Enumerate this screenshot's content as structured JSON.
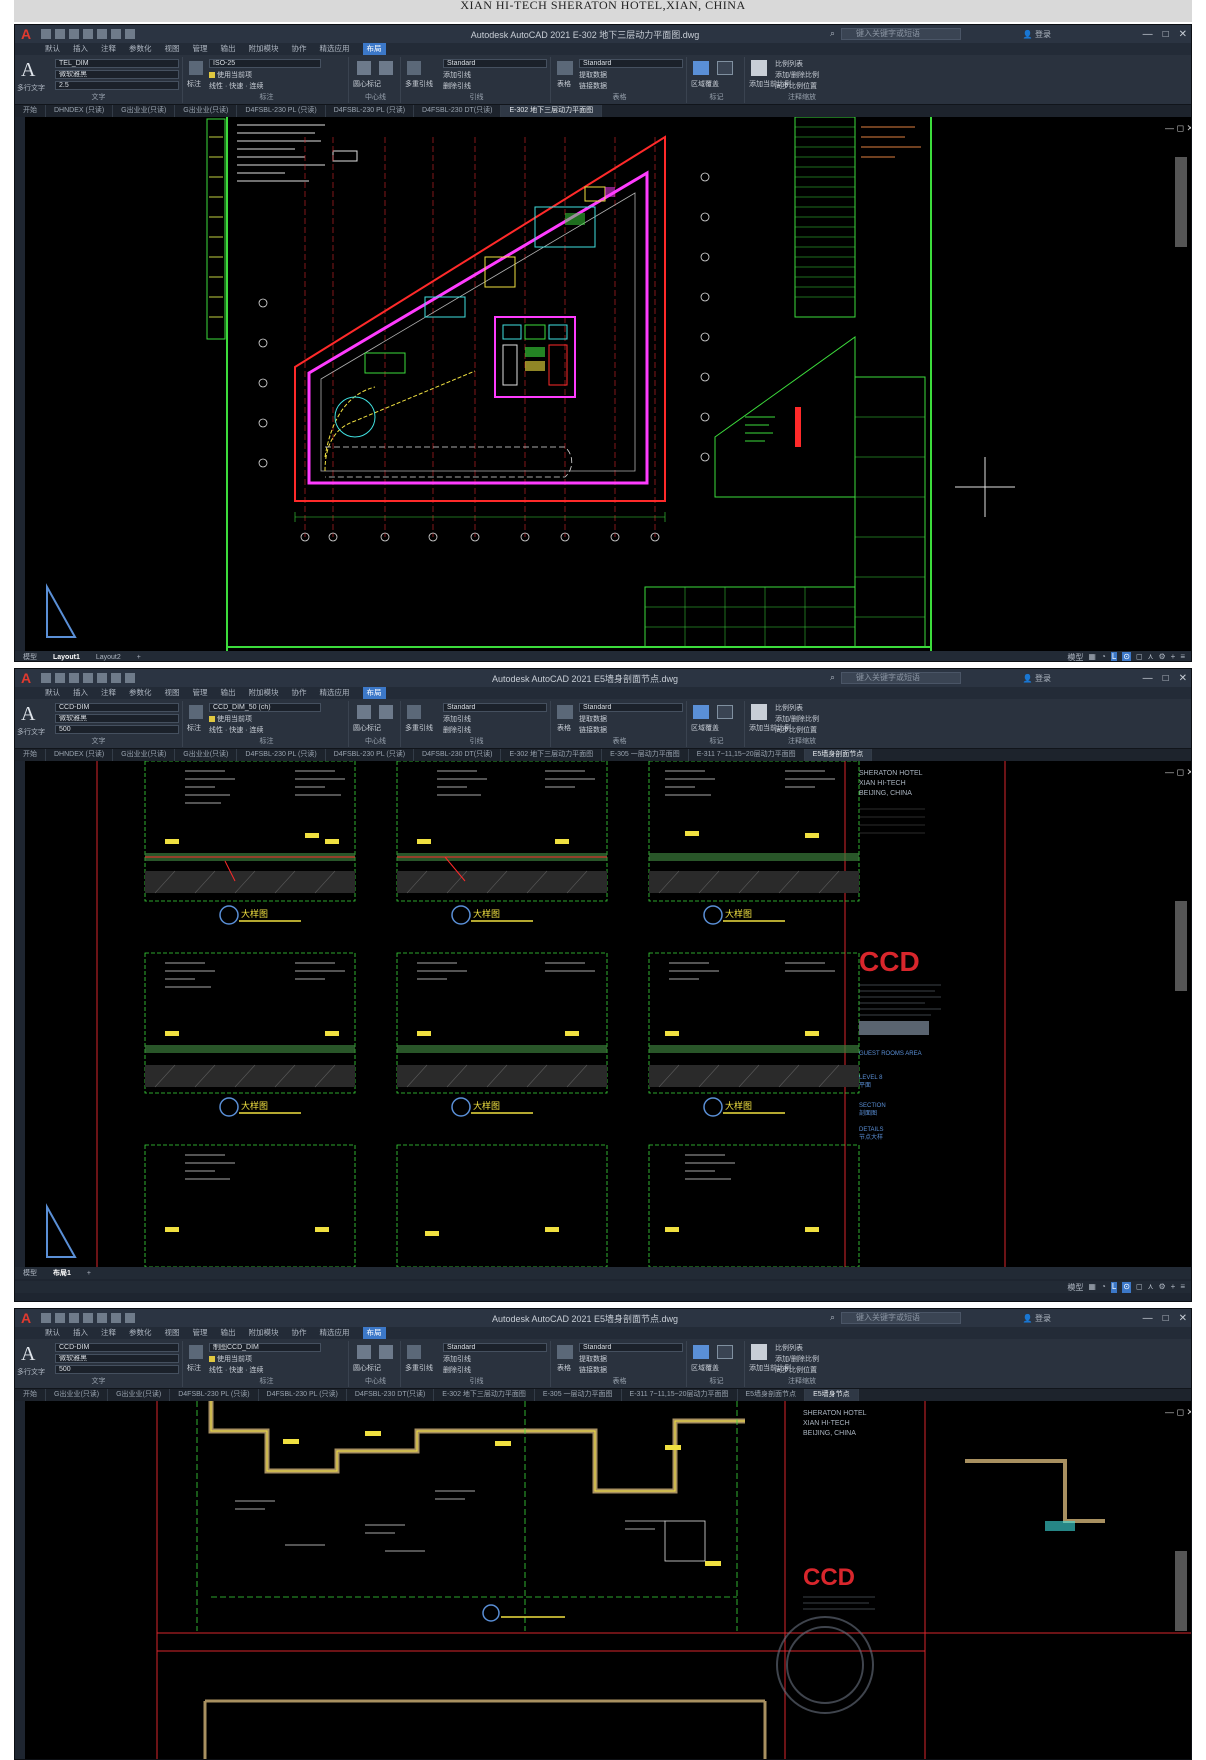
{
  "caption": "XIAN HI-TECH SHERATON HOTEL,XIAN, CHINA",
  "app": {
    "logo": "A",
    "menu_tabs": [
      "默认",
      "插入",
      "注释",
      "参数化",
      "视图",
      "管理",
      "输出",
      "附加模块",
      "协作",
      "精选应用",
      "布局"
    ],
    "active_menu": "布局",
    "ribbon": {
      "text_group": "文字",
      "multiline_text": "多行文字",
      "dim_group": "标注",
      "leader_group": "引线",
      "table_group": "表格",
      "markup_group": "标记",
      "annotation_scale_group": "注释缩放",
      "centerline_group": "中心线",
      "style_standard": "Standard",
      "add_leader": "添加引线",
      "remove_leader": "删除引线",
      "extract_data": "提取数据",
      "link_data": "链接数据",
      "use_current": "使用当前项",
      "linear": "线性",
      "quick": "快速",
      "continue": "连续",
      "scale_list": "比例列表",
      "add_scale": "添加/删除比例",
      "sync_scale": "同步比例位置",
      "dimension_label": "标注",
      "centermark": "圆心标记",
      "centerline": "中心线",
      "mleader": "多重引线",
      "table": "表格",
      "area_mask": "区域覆盖",
      "revcloud": "修订云线",
      "add_current_scale": "添加当前比例"
    },
    "search_placeholder": "键入关键字或短语",
    "user_label": "登录",
    "win_controls": [
      "—",
      "□",
      "✕"
    ],
    "status_model": "模型"
  },
  "windows": [
    {
      "title": "Autodesk AutoCAD 2021   E-302 地下三层动力平面图.dwg",
      "text_style": "TEL_DIM",
      "text_style2": "微软雅黑",
      "text_height": "2.5",
      "dim_style": "ISO-25",
      "doc_tabs": [
        "开始",
        "DHNDEX (只读)",
        "G出业业(只读)",
        "G出业业(只读)",
        "D4FSBL-230 PL (只读)",
        "D4FSBL-230 PL (只读)",
        "D4FSBL-230 DT(只读)",
        "E-302 地下三层动力平面图"
      ],
      "active_doc": 7,
      "layout_tabs": [
        "模型",
        "Layout1",
        "Layout2"
      ],
      "active_layout": 1
    },
    {
      "title": "Autodesk AutoCAD 2021   E5墙身剖面节点.dwg",
      "text_style": "CCD-DIM",
      "text_style2": "微软雅黑",
      "text_height": "500",
      "dim_style": "CCD_DIM_50 (ch)",
      "doc_tabs": [
        "开始",
        "DHNDEX (只读)",
        "G出业业(只读)",
        "G出业业(只读)",
        "D4FSBL-230 PL (只读)",
        "D4FSBL-230 PL (只读)",
        "D4FSBL-230 DT(只读)",
        "E-302 地下三层动力平面图",
        "E-305 一层动力平面图",
        "E-311 7~11,15~20层动力平面图",
        "E5墙身剖面节点"
      ],
      "active_doc": 10,
      "layout_tabs": [
        "模型",
        "布局1"
      ],
      "active_layout": 1,
      "detail_label": "大样图",
      "ccd_logo": "CCD",
      "side_text": [
        "SHERATON HOTEL",
        "XIAN HI-TECH",
        "BEIJING, CHINA"
      ],
      "blue_notes": [
        "GUEST ROOMS AREA",
        "LEVEL 8",
        "平面",
        "SECTION",
        "剖面图",
        "DETAILS",
        "节点大样"
      ]
    },
    {
      "title": "Autodesk AutoCAD 2021   E5墙身剖面节点.dwg",
      "text_style": "CCD-DIM",
      "text_style2": "微软雅黑",
      "text_height": "500",
      "dim_style": "制图CCD_DIM",
      "doc_tabs": [
        "开始",
        "G出业业(只读)",
        "G出业业(只读)",
        "D4FSBL-230 PL (只读)",
        "D4FSBL-230 PL (只读)",
        "D4FSBL-230 DT(只读)",
        "E-302 地下三层动力平面图",
        "E-305 一层动力平面图",
        "E-311 7~11,15~20层动力平面图",
        "E5墙身剖面节点",
        "E5墙身节点"
      ],
      "active_doc": 10,
      "ccd_logo": "CCD",
      "side_text": [
        "SHERATON HOTEL",
        "XIAN HI-TECH",
        "BEIJING, CHINA"
      ]
    }
  ],
  "colors": {
    "bg": "#1e2530",
    "ribbon": "#2a323e",
    "viewport": "#000000",
    "accent": "#3c78c8",
    "magenta": "#ff3cff",
    "red": "#ff2a2a",
    "green": "#3cdc3c",
    "yellow": "#f0e040",
    "cyan": "#40e0e0",
    "ccd_red": "#d8262c"
  }
}
